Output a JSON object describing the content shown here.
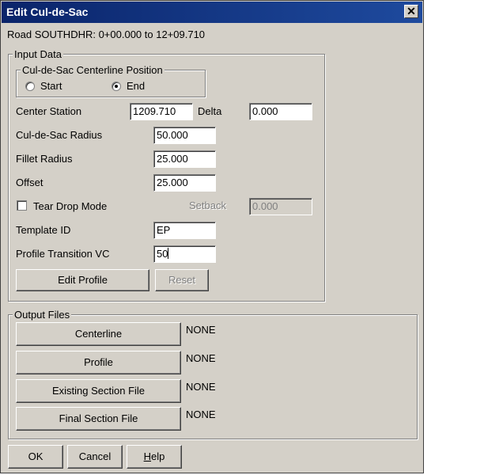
{
  "window": {
    "title": "Edit Cul-de-Sac",
    "close_glyph": "✕"
  },
  "road_info": "Road SOUTHDHR: 0+00.000 to 12+09.710",
  "input_group": {
    "label": "Input Data",
    "position_group": {
      "label": "Cul-de-Sac Centerline Position",
      "start_label": "Start",
      "end_label": "End",
      "selected": "End"
    },
    "center_station": {
      "label": "Center Station",
      "value": "1209.710"
    },
    "delta": {
      "label": "Delta",
      "value": "0.000"
    },
    "radius": {
      "label": "Cul-de-Sac Radius",
      "value": "50.000"
    },
    "fillet": {
      "label": "Fillet Radius",
      "value": "25.000"
    },
    "offset": {
      "label": "Offset",
      "value": "25.000"
    },
    "teardrop": {
      "label": "Tear Drop Mode",
      "checked": false
    },
    "setback": {
      "label": "Setback",
      "value": "0.000"
    },
    "template": {
      "label": "Template ID",
      "value": "EP"
    },
    "profile_vc": {
      "label": "Profile Transition VC",
      "value": "50"
    },
    "edit_profile_label": "Edit Profile",
    "reset_label": "Reset"
  },
  "output_group": {
    "label": "Output Files",
    "rows": [
      {
        "button": "Centerline",
        "value": "NONE"
      },
      {
        "button": "Profile",
        "value": "NONE"
      },
      {
        "button": "Existing Section File",
        "value": "NONE"
      },
      {
        "button": "Final Section File",
        "value": "NONE"
      }
    ]
  },
  "footer": {
    "ok_label": "OK",
    "cancel_label": "Cancel",
    "help_label_first": "H",
    "help_label_rest": "elp"
  }
}
